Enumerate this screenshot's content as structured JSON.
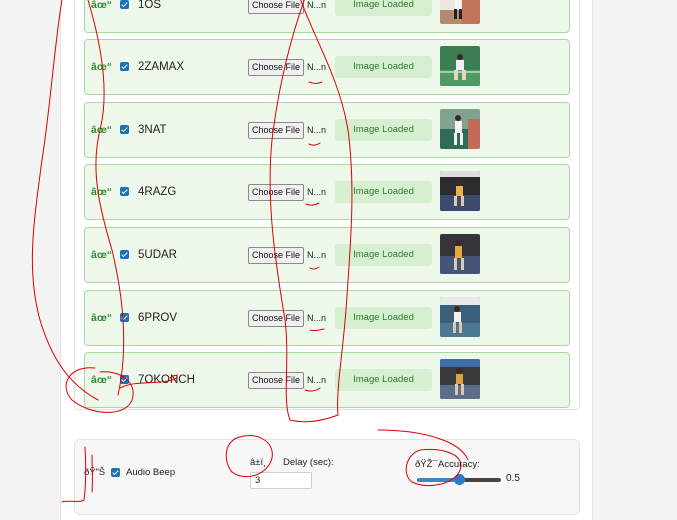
{
  "rows": [
    {
      "mark": "âœ“",
      "name": "1OS",
      "file_button": "Choose File",
      "file_name": "N...n",
      "status": "Image Loaded"
    },
    {
      "mark": "âœ“",
      "name": "2ZAMAX",
      "file_button": "Choose File",
      "file_name": "N...n",
      "status": "Image Loaded"
    },
    {
      "mark": "âœ“",
      "name": "3NAT",
      "file_button": "Choose File",
      "file_name": "N...n",
      "status": "Image Loaded"
    },
    {
      "mark": "âœ“",
      "name": "4RAZG",
      "file_button": "Choose File",
      "file_name": "N...n",
      "status": "Image Loaded"
    },
    {
      "mark": "âœ“",
      "name": "5UDAR",
      "file_button": "Choose File",
      "file_name": "N...n",
      "status": "Image Loaded"
    },
    {
      "mark": "âœ“",
      "name": "6PROV",
      "file_button": "Choose File",
      "file_name": "N...n",
      "status": "Image Loaded"
    },
    {
      "mark": "âœ“",
      "name": "7OKONCH",
      "file_button": "Choose File",
      "file_name": "N...n",
      "status": "Image Loaded"
    }
  ],
  "settings": {
    "audio_icon": "ðŸ”Š",
    "audio_label": "Audio Beep",
    "audio_checked": true,
    "delay_icon": "â±ï¸",
    "delay_label": "Delay (sec):",
    "delay_value": "3",
    "accuracy_icon": "ðŸŽ¯",
    "accuracy_label": "Accuracy:",
    "accuracy_value": "0.5",
    "accuracy_fraction": 0.5
  },
  "colors": {
    "row_bg": "#eef8ea",
    "row_border": "#a9d9a0",
    "status_text": "#2f7d2f",
    "checkbox": "#1a73b8",
    "annotation": "#dd0000"
  }
}
